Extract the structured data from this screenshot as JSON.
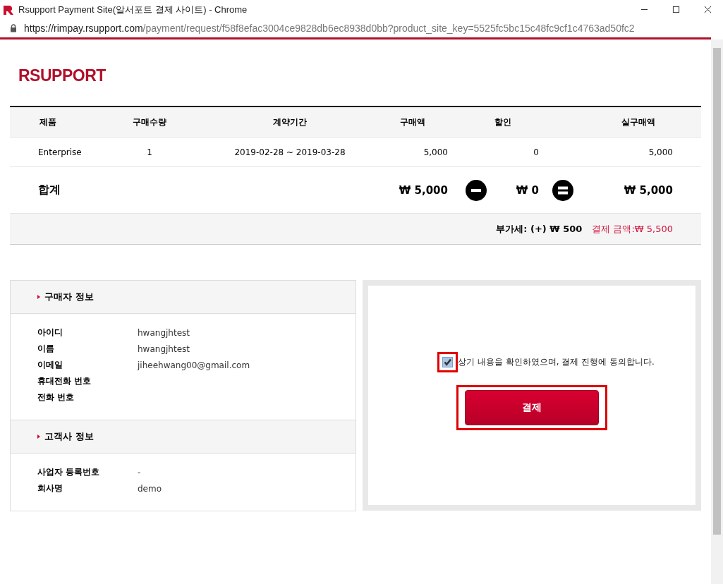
{
  "window": {
    "title": "Rsupport Payment Site(알서포트 결제 사이트) - Chrome",
    "url_host": "https://rimpay.rsupport.com",
    "url_path": "/payment/request/f58f8efac3004ce9828db6ec8938d0bb?product_site_key=5525fc5bc15c48fc9cf1c4763ad50fc2"
  },
  "logo": "RSUPPORT",
  "order_table": {
    "columns": [
      "제품",
      "구매수량",
      "계약기간",
      "구매액",
      "할인",
      "실구매액"
    ],
    "rows": [
      {
        "product": "Enterprise",
        "quantity": "1",
        "period": "2019-02-28 ~ 2019-03-28",
        "price": "5,000",
        "discount": "0",
        "net": "5,000"
      }
    ],
    "total": {
      "label": "합계",
      "price": "₩ 5,000",
      "discount": "₩ 0",
      "net": "₩ 5,000"
    },
    "vat": {
      "label": "부가세: (+) ₩ 500",
      "amount": "결제 금액:₩ 5,500"
    }
  },
  "info_sections": [
    {
      "title": "구매자 정보",
      "fields": [
        {
          "label": "아이디",
          "value": "hwangjhtest"
        },
        {
          "label": "이름",
          "value": "hwangjhtest"
        },
        {
          "label": "이메일",
          "value": "jiheehwang00@gmail.com"
        },
        {
          "label": "휴대전화 번호"
        },
        {
          "label": "전화 번호"
        }
      ]
    },
    {
      "title": "고객사 정보",
      "fields": [
        {
          "label": "사업자 등록번호",
          "value": "-"
        },
        {
          "label": "회사명",
          "value": "demo"
        }
      ]
    }
  ],
  "agreement": {
    "text": "상기 내용을 확인하였으며, 결제 진행에 동의합니다.",
    "checked": true,
    "highlighted": true
  },
  "pay_button": {
    "label": "결제",
    "highlighted": true
  }
}
